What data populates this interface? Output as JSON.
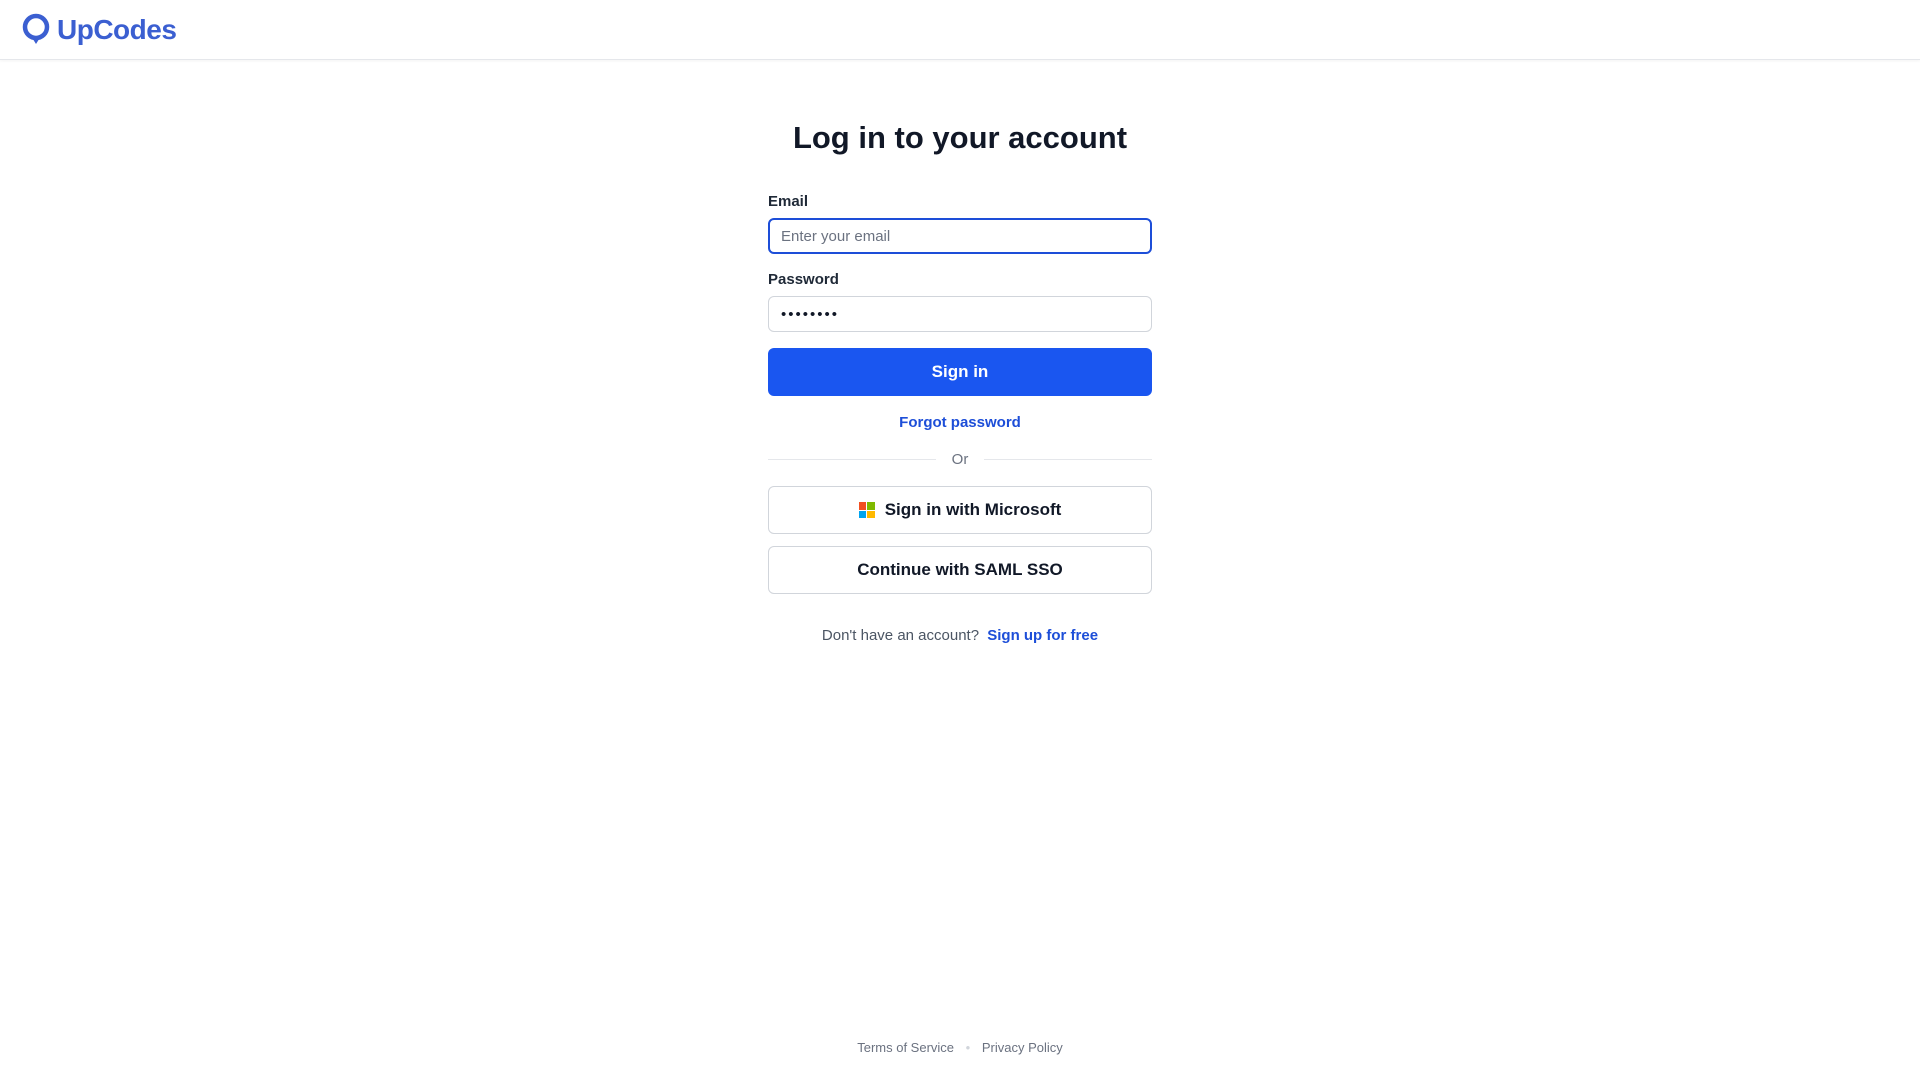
{
  "brand": {
    "name": "UpCodes",
    "color": "#3b5fd1"
  },
  "login": {
    "title": "Log in to your account",
    "email_label": "Email",
    "email_placeholder": "Enter your email",
    "email_value": "",
    "password_label": "Password",
    "password_value": "••••••••",
    "sign_in_label": "Sign in",
    "forgot_password": "Forgot password",
    "divider_text": "Or",
    "microsoft_label": "Sign in with Microsoft",
    "saml_label": "Continue with SAML SSO",
    "no_account_text": "Don't have an account?",
    "signup_link": "Sign up for free",
    "primary_color": "#1a56f0"
  },
  "microsoft_icon": {
    "name": "microsoft-logo-icon",
    "colors": [
      "#f25022",
      "#7fba00",
      "#00a4ef",
      "#ffb900"
    ]
  },
  "footer": {
    "terms": "Terms of Service",
    "separator": "•",
    "privacy": "Privacy Policy"
  }
}
